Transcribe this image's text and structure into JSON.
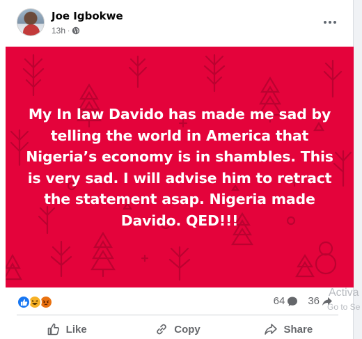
{
  "post": {
    "author": "Joe Igbokwe",
    "time": "13h",
    "separator": "·",
    "text_lines": [
      "My In law Davido has made me sad by",
      "telling the world in America that",
      "Nigeria’s economy is in shambles. This",
      "is very sad. I will advise him to retract",
      "the statement asap. Nigeria made",
      "Davido. QED!!!"
    ],
    "background_color": "#e4033b"
  },
  "engagement": {
    "reactions": [
      "like",
      "haha",
      "angry"
    ],
    "comments_count": "64",
    "shares_count": "36"
  },
  "actions": {
    "like_label": "Like",
    "copy_label": "Copy",
    "share_label": "Share"
  },
  "overlay": {
    "activate_text": "Activa",
    "goto_text": "Go to Se"
  },
  "icons": {
    "privacy": "globe-icon",
    "menu": "more-options-icon",
    "comment": "comment-bubble-icon",
    "share": "share-arrow-icon",
    "like": "thumbs-up-icon",
    "copy": "link-icon"
  }
}
